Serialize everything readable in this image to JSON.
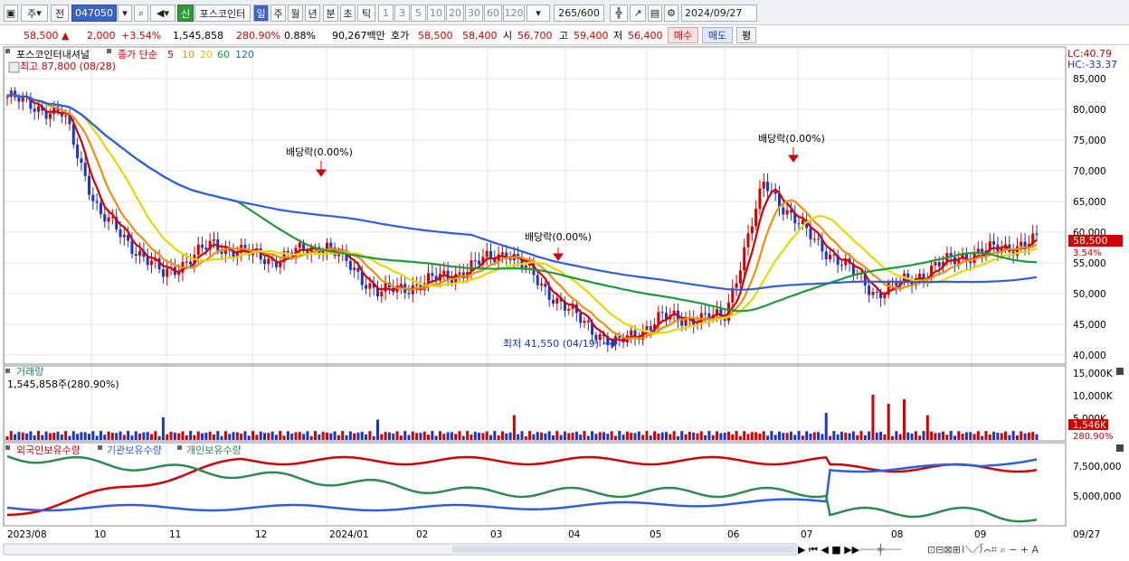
{
  "toolbar": {
    "type_label": "주",
    "prev_label": "전",
    "code": "047050",
    "badge": "신",
    "name": "포스코인터",
    "periods": [
      "일",
      "주",
      "월",
      "년",
      "분",
      "초",
      "틱"
    ],
    "minutes": [
      "1",
      "3",
      "5",
      "10",
      "20",
      "30",
      "60",
      "120"
    ],
    "count": "265",
    "count_total": "/600",
    "date": "2024/09/27"
  },
  "quote": {
    "price": "58,500",
    "arrow": "▲",
    "change": "2,000",
    "change_pct": "+3.54%",
    "volume": "1,545,858",
    "vol_ratio": "280.90%",
    "turnover": "0.88%",
    "amount": "90,267백만",
    "ask_label": "호가",
    "ask1": "58,500",
    "ask2": "58,400",
    "open_label": "시",
    "open": "56,700",
    "high_label": "고",
    "high": "59,400",
    "low_label": "저",
    "low": "56,400",
    "buy": "매수",
    "sell": "매도",
    "flat": "평"
  },
  "price_panel": {
    "name": "포스코인터내셔널",
    "ma_label": "종가 단순",
    "ma_periods": [
      "5",
      "10",
      "20",
      "60",
      "120"
    ],
    "ma_colors": [
      "#d40000",
      "#f0900a",
      "#e6d800",
      "#1e9a3a",
      "#2f5fdc"
    ],
    "high_note": "최고 87,800 (08/28)",
    "low_note": "최저 41,550 (04/19)",
    "lc": "LC:40.79",
    "hc": "HC:-33.37",
    "dividends": [
      "배당락(0.00%)",
      "배당락(0.00%)",
      "배당락(0.00%)"
    ],
    "y_ticks": [
      "85,000",
      "80,000",
      "75,000",
      "70,000",
      "65,000",
      "60,000",
      "55,000",
      "50,000",
      "45,000",
      "40,000"
    ],
    "last_price": "58,500",
    "last_pct": "3.54%"
  },
  "volume_panel": {
    "title": "거래량",
    "value": "1,545,858주(280.90%)",
    "y_ticks": [
      "15,000K",
      "10,000K",
      "5,000K"
    ],
    "last_vol": "1,546K",
    "last_pct": "280.90%"
  },
  "holder_panel": {
    "legends": [
      "외국인보유수량",
      "기관보유수량",
      "개인보유수량"
    ],
    "colors": [
      "#d40000",
      "#2f5fdc",
      "#2e8a50"
    ],
    "y_ticks": [
      "7,500,000",
      "5,000,000"
    ]
  },
  "x_axis": [
    "2023/08",
    "10",
    "11",
    "12",
    "2024/01",
    "02",
    "03",
    "04",
    "05",
    "06",
    "07",
    "08",
    "09",
    "09/27"
  ],
  "chart_data": {
    "type": "line",
    "y_range": [
      40000,
      87800
    ],
    "close": [
      {
        "x": "2023/08",
        "y": 82000
      },
      {
        "x": "2023/09",
        "y": 79000
      },
      {
        "x": "2023/10",
        "y": 63000
      },
      {
        "x": "2023/11",
        "y": 53000
      },
      {
        "x": "2023/11-b",
        "y": 58000
      },
      {
        "x": "2023/12",
        "y": 55500
      },
      {
        "x": "2024/01",
        "y": 58000
      },
      {
        "x": "2024/01-b",
        "y": 50000
      },
      {
        "x": "2024/02",
        "y": 53000
      },
      {
        "x": "2024/03",
        "y": 57000
      },
      {
        "x": "2024/04",
        "y": 47000
      },
      {
        "x": "2024/04/19",
        "y": 41550
      },
      {
        "x": "2024/05",
        "y": 46000
      },
      {
        "x": "2024/06",
        "y": 46000
      },
      {
        "x": "2024/06-b",
        "y": 68000
      },
      {
        "x": "2024/07",
        "y": 60000
      },
      {
        "x": "2024/08",
        "y": 50000
      },
      {
        "x": "2024/09",
        "y": 56000
      },
      {
        "x": "2024/09/27",
        "y": 58500
      }
    ]
  }
}
